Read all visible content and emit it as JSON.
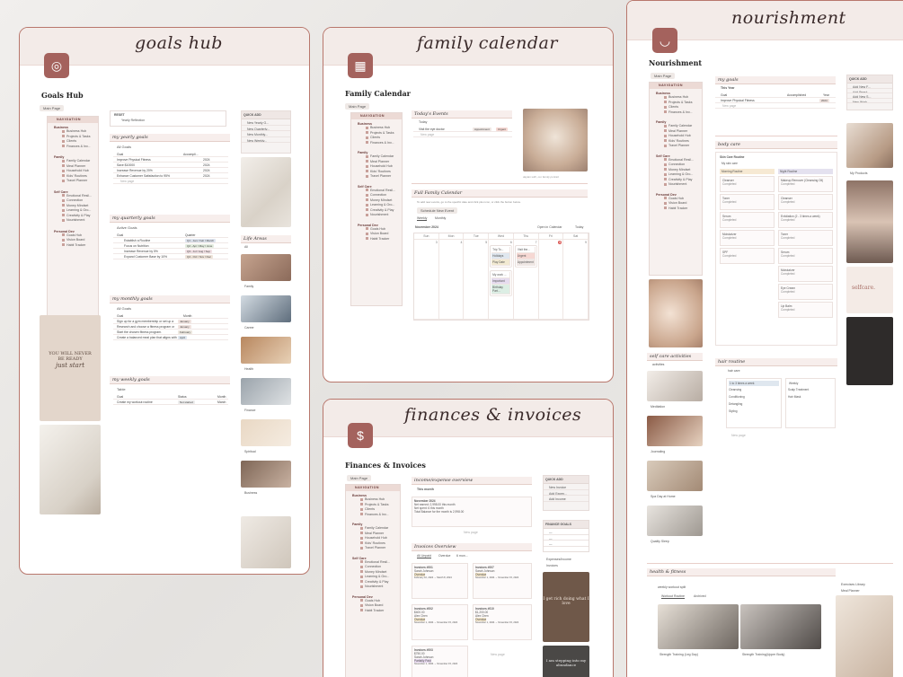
{
  "goals": {
    "script": "goals hub",
    "title": "Goals Hub",
    "main_page": "Main Page",
    "nav": {
      "header": "NAVIGATION",
      "groups": [
        {
          "name": "Business",
          "items": [
            "Business Hub",
            "Projects & Tasks",
            "Clients",
            "Finances & Inv..."
          ]
        },
        {
          "name": "Family",
          "items": [
            "Family Calendar",
            "Meal Planner",
            "Household Hub",
            "Kids' Routines",
            "Travel Planner"
          ]
        },
        {
          "name": "Self Care",
          "items": [
            "Emotional Resil...",
            "Connection",
            "Money Mindset",
            "Learning & Gro...",
            "Creativity & Play",
            "Nourishment"
          ]
        },
        {
          "name": "Personal Dev",
          "items": [
            "Goals Hub",
            "Vision Board",
            "Habit Tracker"
          ]
        }
      ]
    },
    "reset": {
      "title": "RESET",
      "item": "Yearly Reflection"
    },
    "yearly": {
      "heading": "my yearly goals",
      "view": "All Goals",
      "cols": [
        "Goal",
        "Accompli..."
      ],
      "rows": [
        {
          "name": "Improve Physical Fitness",
          "year": "2024"
        },
        {
          "name": "Save $10000",
          "year": "2024"
        },
        {
          "name": "Increase Revenue by 20%",
          "year": "2024"
        },
        {
          "name": "Enhance Customer Satisfaction to 95%",
          "year": "2024"
        }
      ],
      "new_page": "New page"
    },
    "quarterly": {
      "heading": "my quarterly goals",
      "view": "Active Goals",
      "cols": [
        "Goal",
        "Quarter"
      ],
      "rows": [
        {
          "name": "Establish a Routine",
          "q": "Q1 - Jan / Feb / March"
        },
        {
          "name": "Focus on Nutrition",
          "q": "Q2 - Apr / May / June"
        },
        {
          "name": "Increase Revenue by 5%",
          "q": "Q3 - Jul / Aug / Sep"
        },
        {
          "name": "Expand Customer Base by 10%",
          "q": "Q4 - Oct / Nov / Dec"
        }
      ]
    },
    "monthly": {
      "heading": "my monthly goals",
      "view": "All Goals",
      "cols": [
        "Goal",
        "Month"
      ],
      "rows": [
        {
          "name": "Sign up for a gym membership or set up a",
          "m": "January"
        },
        {
          "name": "Research and choose a fitness program or",
          "m": "January"
        },
        {
          "name": "Start the chosen fitness program.",
          "m": "February"
        },
        {
          "name": "Create a balanced meal plan that aligns with",
          "m": "April"
        }
      ]
    },
    "weekly": {
      "heading": "my weekly goals",
      "view": "Table",
      "cols": [
        "Goal",
        "Status",
        "Month"
      ],
      "rows": [
        {
          "name": "Create my workout routine",
          "s": "Not started",
          "m": "March"
        }
      ]
    },
    "quick": {
      "header": "QUICK ADD",
      "items": [
        "New Yearly G...",
        "New Quarterly...",
        "New Monthly...",
        "New Weekly..."
      ]
    },
    "life_areas": {
      "heading": "Life Areas",
      "view": "All",
      "items": [
        "Family",
        "Career",
        "Health",
        "Finance",
        "Spiritual",
        "Business"
      ]
    },
    "poster": {
      "line1": "YOU WILL NEVER",
      "line2": "BE READY",
      "line3": "just start"
    }
  },
  "family": {
    "script": "family calendar",
    "title": "Family Calendar",
    "main_page": "Main Page",
    "today": {
      "heading": "Today's Events",
      "view": "Today",
      "row": "Visit the eye doctor",
      "tag1": "Appointment",
      "tag2": "Urgent",
      "new_page": "New page"
    },
    "photo_caption": "daylan with, our family portrait",
    "full": {
      "heading": "Full Family Calendar",
      "hint": "To add new events, go to the specific date and click plus icon, or click the button below.",
      "button": "Schedule New Event",
      "tabs": [
        "Weekly",
        "Monthly"
      ],
      "month": "November 2024",
      "open": "Open in Calendar",
      "today": "Today",
      "days": [
        "Sun",
        "Mon",
        "Tue",
        "Wed",
        "Thu",
        "Fri",
        "Sat"
      ],
      "dates": [
        "3",
        "4",
        "5",
        "6",
        "7",
        "8",
        "9"
      ],
      "ev1": "Trip To...",
      "ev1tags": [
        "Holidays",
        "Play Date"
      ],
      "ev2": "Visit the...",
      "ev2tags": [
        "Urgent",
        "Appointment"
      ],
      "ev3": "My work ...",
      "ev3tags": [
        "Important",
        "Birthday Part..."
      ]
    }
  },
  "finances": {
    "script": "finances & invoices",
    "title": "Finances & Invoices",
    "main_page": "Main Page",
    "overview": {
      "heading": "income/expense overview",
      "view": "This month",
      "month": "November 2024",
      "lines": [
        "Net earned: 2,998.00 this month",
        "Net spent: 6 this month",
        "Total Balance for the month is 2,998.00"
      ],
      "new_page": "New page"
    },
    "invoices": {
      "heading": "Invoices Overview",
      "tabs": [
        "All Unpaid",
        "Overdue",
        "6 mon..."
      ],
      "cards": [
        {
          "id": "Invoices #001",
          "name": "Sarah Johnson",
          "status": "Overdue",
          "date": "February 10, 2024 → March 8, 2024",
          "amt": ""
        },
        {
          "id": "Invoices #007",
          "name": "Sarah Johnson",
          "status": "Overdue",
          "date": "November 1, 2024 → November 15, 2024",
          "amt": ""
        },
        {
          "id": "Invoices #002",
          "name": "Alex Chen",
          "status": "Overdue",
          "date": "November 1, 2024 → November 15, 2024",
          "amt": "$400.00"
        },
        {
          "id": "Invoices #010",
          "name": "Alex Chen",
          "status": "Overdue",
          "date": "November 1, 2024 → November 15, 2024",
          "amt": "$1,200.00"
        },
        {
          "id": "Invoices #003",
          "name": "Sarah Johnson",
          "status": "Partially Paid",
          "date": "November 1, 2024 → November 15, 2024",
          "amt": "$750.00"
        }
      ],
      "new_page": "New page"
    },
    "quick": {
      "header": "QUICK ADD",
      "items": [
        "New Invoice",
        "Add Expen...",
        "Add Income"
      ]
    },
    "goals": {
      "header": "FINANCE GOALS",
      "items": [
        "—",
        "—",
        "—"
      ]
    },
    "links": [
      "Expenses/Income",
      "Invoices"
    ],
    "poster1": "I get rich doing what I love",
    "poster2": "I am stepping into my abundance"
  },
  "nourish": {
    "script": "nourishment",
    "title": "Nourishment",
    "main_page": "Main Page",
    "goals": {
      "heading": "my goals",
      "view": "This Year",
      "cols": [
        "Goal",
        "Accomplished",
        "Year"
      ],
      "row": "Improve Physical Fitness",
      "year": "2024",
      "new_page": "New page"
    },
    "quick": {
      "header": "QUICK ADD",
      "items": [
        "Add New F...",
        "Add Beaut...",
        "Add New S...",
        "New Work...",
        "Add New..."
      ]
    },
    "products": "My Products",
    "body": {
      "heading": "body care",
      "title": "Skin Care Routine",
      "view": "My skin care",
      "morning": "Morning Routine",
      "night": "Night Routine",
      "morning_items": [
        "Cleanser",
        "Toner",
        "Serum",
        "Moisturizer",
        "SPF"
      ],
      "night_items": [
        "Makeup Remover (Cleansing Oil)",
        "Cleanser",
        "Exfoliation (2 - 3 times a week)",
        "Toner",
        "Serum",
        "Moisturizer",
        "Eye Cream",
        "Lip Balm"
      ],
      "completed": "Completed",
      "new_page": "New page"
    },
    "activities": {
      "heading": "self care activities",
      "view": "activities",
      "items": [
        "Meditation",
        "Journaling",
        "Spa Day at Home",
        "Quality Sleep"
      ]
    },
    "hair": {
      "heading": "hair routine",
      "view": "hair care",
      "col1": "1 to 3 times a week",
      "col2": "Weekly",
      "items1": [
        "Cleansing",
        "Conditioning",
        "Detangling",
        "Styling"
      ],
      "items2": [
        "Scalp Treatment",
        "Hair Mask"
      ],
      "new_page": "New page"
    },
    "selfcare_card": "selfcare.",
    "health": {
      "heading": "health & fitness",
      "view": "weekly workout split",
      "tabs": [
        "Workout Routine",
        "Archived"
      ],
      "items": [
        "Strength Training (Leg Day)",
        "Strength Training(Upper Body)"
      ],
      "lib": "Exercises Library",
      "lib_item": "Meal Planner"
    }
  }
}
